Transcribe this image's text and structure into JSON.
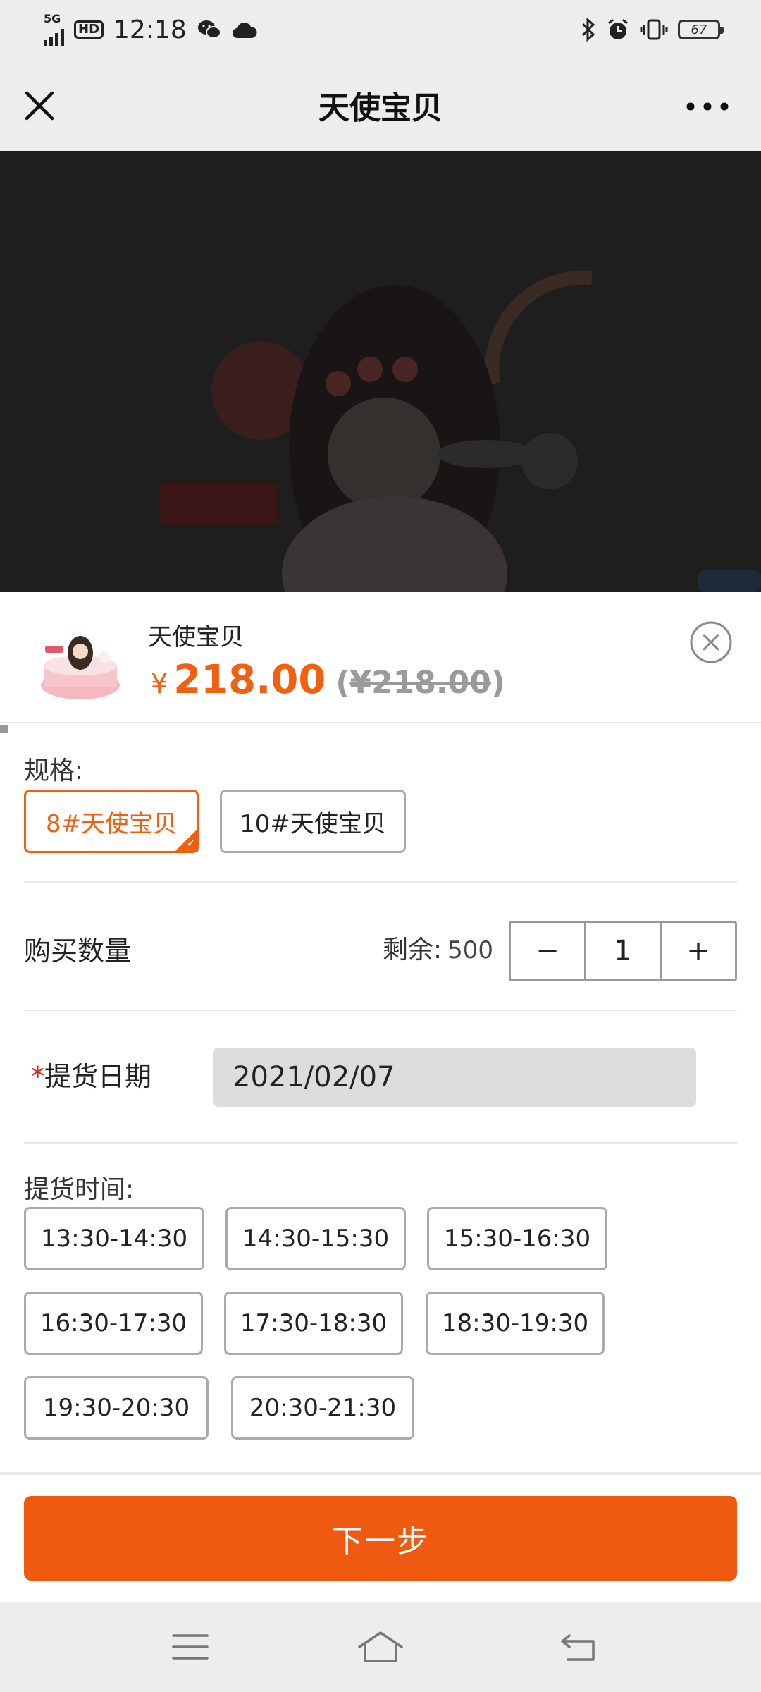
{
  "status_bar": {
    "network": "5G",
    "hd": "HD",
    "time": "12:18",
    "battery": "67",
    "icons": [
      "signal-icon",
      "wechat-icon",
      "cloud-icon",
      "bluetooth-icon",
      "alarm-icon",
      "vibrate-icon",
      "battery-icon"
    ]
  },
  "title_bar": {
    "title": "天使宝贝",
    "icons": [
      "close-icon",
      "more-icon"
    ]
  },
  "product": {
    "name": "天使宝贝",
    "currency": "¥",
    "price": "218.00",
    "original_price": "¥218.00",
    "orig_open": "(",
    "orig_close": ")"
  },
  "spec": {
    "label": "规格:",
    "options": [
      "8#天使宝贝",
      "10#天使宝贝"
    ],
    "selected": "8#天使宝贝"
  },
  "quantity": {
    "label": "购买数量",
    "stock_label": "剩余:",
    "stock_value": "500",
    "minus": "−",
    "value": "1",
    "plus": "+"
  },
  "pickup_date": {
    "required_mark": "*",
    "label": "提货日期",
    "value": "2021/02/07"
  },
  "pickup_time": {
    "label": "提货时间:",
    "slots": [
      "13:30-14:30",
      "14:30-15:30",
      "15:30-16:30",
      "16:30-17:30",
      "17:30-18:30",
      "18:30-19:30",
      "19:30-20:30",
      "20:30-21:30"
    ]
  },
  "next_button": "下一步",
  "colors": {
    "accent": "#f06010",
    "button": "#f05a10",
    "required": "#e02020",
    "header_bg": "#ededed"
  },
  "nav_bar": {
    "icons": [
      "menu-icon",
      "home-icon",
      "back-icon"
    ]
  }
}
